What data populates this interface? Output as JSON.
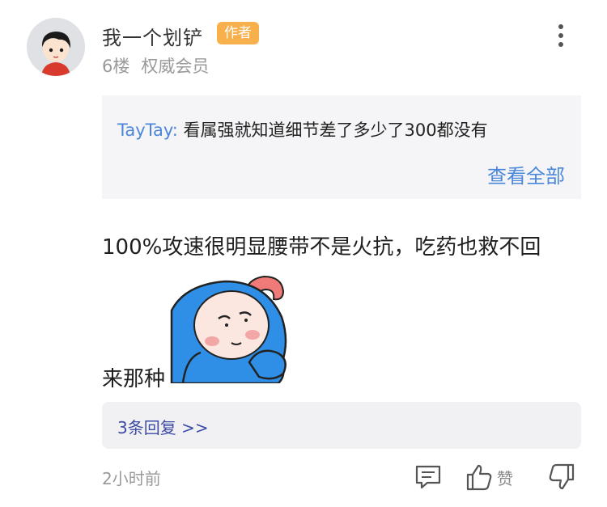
{
  "comment": {
    "username": "我一个划铲",
    "badge": "作者",
    "floor": "6楼",
    "rank": "权威会员",
    "quote": {
      "author": "TayTay:",
      "text": "看属强就知道细节差了多少了300都没有",
      "view_all": "查看全部"
    },
    "text_line1": "100%攻速很明显腰带不是火抗，吃药也救不回",
    "text_line2": "来那种",
    "sticker_icon": "blue-hood-character-sticker",
    "replies_link": "3条回复 >>",
    "time": "2小时前",
    "like_label": "赞"
  },
  "icons": {
    "more": "more-vertical-icon",
    "reply": "comment-icon",
    "like": "thumbs-up-icon",
    "dislike": "thumbs-down-icon"
  },
  "colors": {
    "badge": "#f8b04c",
    "link_blue": "#4a86d9",
    "reply_link": "#3d4aa6",
    "quote_bg": "#f5f5f7"
  }
}
